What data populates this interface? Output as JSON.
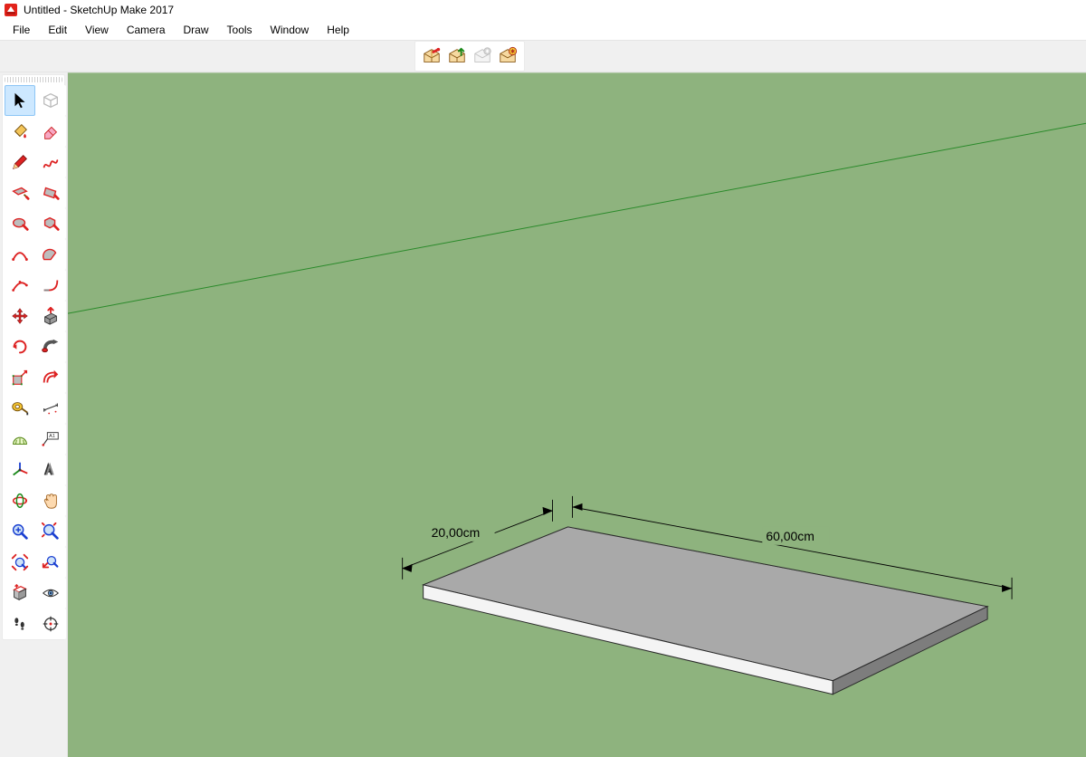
{
  "window": {
    "title": "Untitled - SketchUp Make 2017"
  },
  "menu": {
    "items": [
      "File",
      "Edit",
      "View",
      "Camera",
      "Draw",
      "Tools",
      "Window",
      "Help"
    ]
  },
  "warehouse_toolbar": {
    "items": [
      {
        "name": "3d-warehouse-open",
        "enabled": true
      },
      {
        "name": "3d-warehouse-share",
        "enabled": true
      },
      {
        "name": "extension-warehouse",
        "enabled": false
      },
      {
        "name": "extension-manager",
        "enabled": true
      }
    ]
  },
  "tools": {
    "selected": "select",
    "left": [
      {
        "name": "select",
        "icon": "cursor"
      },
      {
        "name": "paint-bucket",
        "icon": "bucket"
      },
      {
        "name": "line",
        "icon": "pencil"
      },
      {
        "name": "rectangle",
        "icon": "rect"
      },
      {
        "name": "circle",
        "icon": "circle"
      },
      {
        "name": "arc-2pt",
        "icon": "arc"
      },
      {
        "name": "arc-3pt",
        "icon": "arc3"
      },
      {
        "name": "move",
        "icon": "move"
      },
      {
        "name": "rotate",
        "icon": "rotate"
      },
      {
        "name": "scale",
        "icon": "scale"
      },
      {
        "name": "tape-measure",
        "icon": "tape"
      },
      {
        "name": "protractor",
        "icon": "protractor"
      },
      {
        "name": "axes",
        "icon": "axes"
      },
      {
        "name": "orbit",
        "icon": "orbit"
      },
      {
        "name": "zoom",
        "icon": "zoom-in"
      },
      {
        "name": "zoom-selection",
        "icon": "zoom-sel"
      },
      {
        "name": "section-plane",
        "icon": "section"
      },
      {
        "name": "walk",
        "icon": "walk"
      }
    ],
    "right": [
      {
        "name": "make-component",
        "icon": "component",
        "disabled": true
      },
      {
        "name": "eraser",
        "icon": "eraser"
      },
      {
        "name": "freehand",
        "icon": "freehand"
      },
      {
        "name": "rotated-rectangle",
        "icon": "rrect"
      },
      {
        "name": "polygon",
        "icon": "polygon"
      },
      {
        "name": "arc-pie",
        "icon": "pie"
      },
      {
        "name": "arc-tangent",
        "icon": "arc-tan"
      },
      {
        "name": "push-pull",
        "icon": "pushpull"
      },
      {
        "name": "follow-me",
        "icon": "followme"
      },
      {
        "name": "offset",
        "icon": "offset"
      },
      {
        "name": "dimension",
        "icon": "dim"
      },
      {
        "name": "text",
        "icon": "text"
      },
      {
        "name": "3d-text",
        "icon": "text3d"
      },
      {
        "name": "pan",
        "icon": "pan"
      },
      {
        "name": "zoom-extents",
        "icon": "zoom-ext"
      },
      {
        "name": "zoom-previous",
        "icon": "zoom-prev"
      },
      {
        "name": "look-around",
        "icon": "eye"
      },
      {
        "name": "position-camera",
        "icon": "target"
      }
    ]
  },
  "viewport": {
    "bg_color": "#8eb37e",
    "ground_line_color": "#2a8a2a",
    "dimensions": {
      "depth": "20,00cm",
      "width": "60,00cm"
    }
  }
}
